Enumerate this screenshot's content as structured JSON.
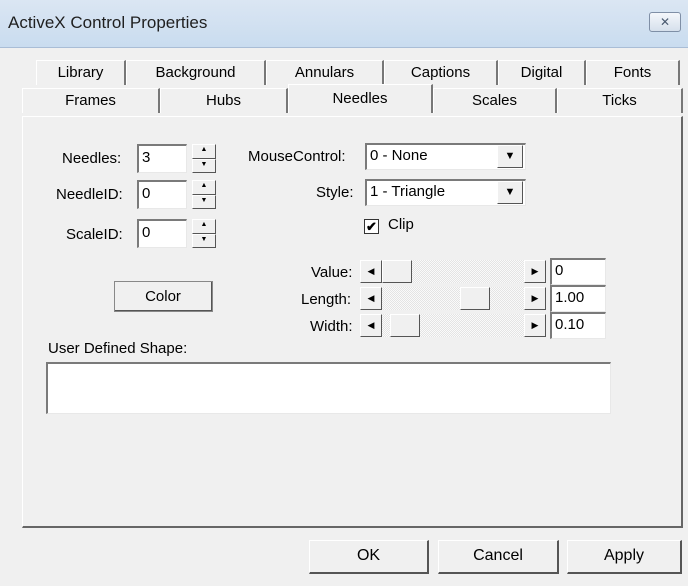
{
  "window": {
    "title": "ActiveX Control Properties",
    "close_icon": "close-icon",
    "close_glyph": "✕"
  },
  "tabs_row1": [
    "Library",
    "Background",
    "Annulars",
    "Captions",
    "Digital",
    "Fonts"
  ],
  "tabs_row2": [
    "Frames",
    "Hubs",
    "Needles",
    "Scales",
    "Ticks"
  ],
  "active_tab": "Needles",
  "fields": {
    "needles": {
      "label": "Needles:",
      "value": "3"
    },
    "needle_id": {
      "label": "NeedleID:",
      "value": "0"
    },
    "scale_id": {
      "label": "ScaleID:",
      "value": "0"
    }
  },
  "mouse_control": {
    "label": "MouseControl:",
    "value": "0 - None"
  },
  "style": {
    "label": "Style:",
    "value": "1 - Triangle"
  },
  "clip": {
    "label": "Clip",
    "checked": true
  },
  "color_button": "Color",
  "sliders": {
    "value": {
      "label": "Value:",
      "text": "0",
      "level": 0.0
    },
    "length": {
      "label": "Length:",
      "text": "1.00",
      "level": 0.7
    },
    "width": {
      "label": "Width:",
      "text": "0.10",
      "level": 0.07
    }
  },
  "user_defined_shape": {
    "label": "User Defined Shape:",
    "value": ""
  },
  "buttons": {
    "ok": "OK",
    "cancel": "Cancel",
    "apply": "Apply"
  },
  "glyphs": {
    "up": "▲",
    "down": "▼",
    "left": "◀",
    "right": "▶",
    "check": "✔"
  }
}
